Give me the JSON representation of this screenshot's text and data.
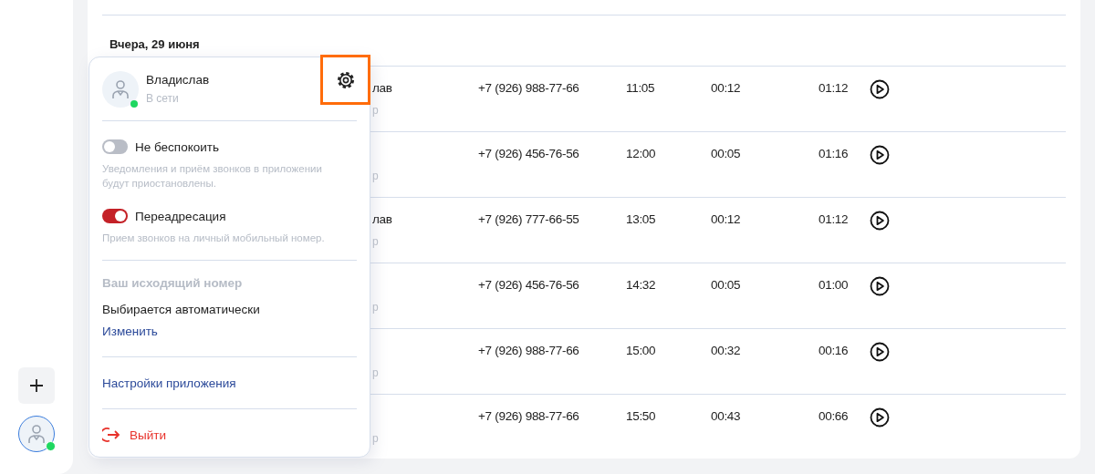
{
  "date_header": "Вчера, 29 июня",
  "calls": [
    {
      "name_fragment": "лав",
      "sub_fragment": "р",
      "phone": "+7 (926) 988-77-66",
      "time": "11:05",
      "wait": "00:12",
      "duration": "01:12"
    },
    {
      "sub_fragment": "р",
      "phone": "+7 (926) 456-76-56",
      "time": "12:00",
      "wait": "00:05",
      "duration": "01:16"
    },
    {
      "name_fragment": "лав",
      "sub_fragment": "р",
      "phone": "+7 (926) 777-66-55",
      "time": "13:05",
      "wait": "00:12",
      "duration": "01:12"
    },
    {
      "sub_fragment": "р",
      "phone": "+7 (926) 456-76-56",
      "time": "14:32",
      "wait": "00:05",
      "duration": "01:00"
    },
    {
      "sub_fragment": "р",
      "phone": "+7 (926) 988-77-66",
      "time": "15:00",
      "wait": "00:32",
      "duration": "00:16"
    },
    {
      "sub_fragment": "р",
      "phone": "+7 (926) 988-77-66",
      "time": "15:50",
      "wait": "00:43",
      "duration": "00:66"
    }
  ],
  "profile_menu": {
    "name": "Владислав",
    "status": "В сети",
    "online": true,
    "settings_highlighted": true,
    "toggles": [
      {
        "label": "Не беспокоить",
        "description": "Уведомления и приём звонков в приложении будут приостановлены.",
        "on": false
      },
      {
        "label": "Переадресация",
        "description": "Прием звонков на личный мобильный номер.",
        "on": true
      }
    ],
    "outgoing": {
      "heading": "Ваш исходящий номер",
      "value": "Выбирается автоматически",
      "link": "Изменить"
    },
    "app_settings": "Настройки приложения",
    "logout": "Выйти"
  },
  "sidebar": {
    "online": true
  }
}
